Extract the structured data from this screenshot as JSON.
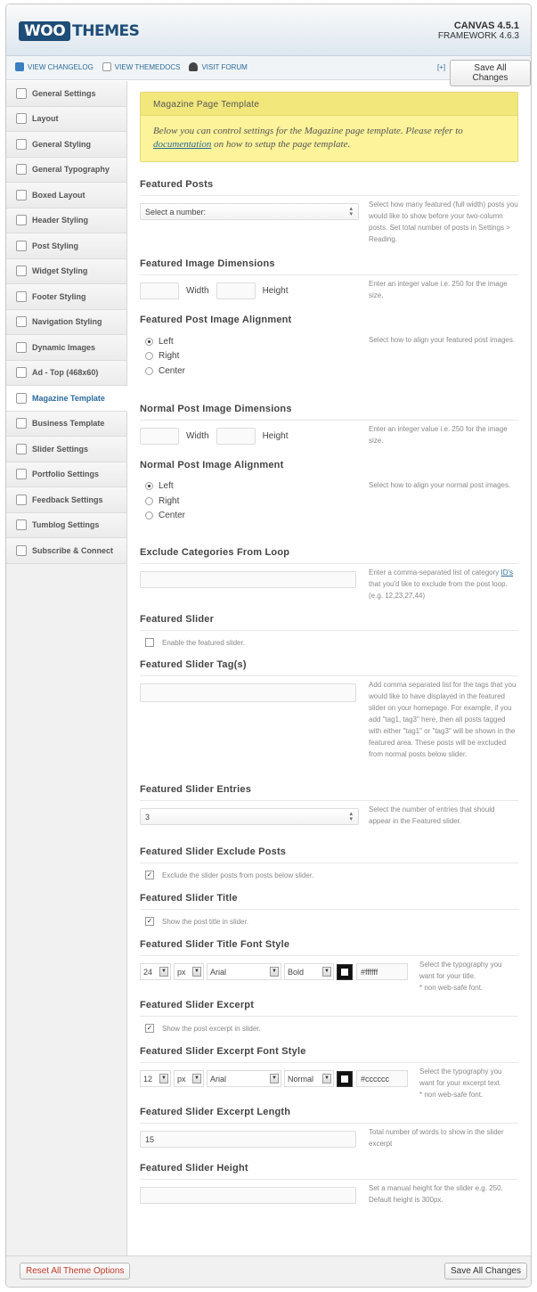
{
  "header": {
    "logo_woo": "WOO",
    "logo_themes": "THEMES",
    "version": "CANVAS 4.5.1",
    "framework": "FRAMEWORK 4.6.3"
  },
  "subbar": {
    "links": [
      {
        "label": "VIEW CHANGELOG",
        "icon": "changelog-icon"
      },
      {
        "label": "VIEW THEMEDOCS",
        "icon": "document-icon"
      },
      {
        "label": "VISIT FORUM",
        "icon": "user-icon"
      }
    ],
    "expand": "[+]",
    "save_label": "Save All Changes"
  },
  "sidebar": {
    "items": [
      {
        "label": "General Settings",
        "icon": "wrench-icon"
      },
      {
        "label": "Layout",
        "icon": "layout-icon"
      },
      {
        "label": "General Styling",
        "icon": "paint-bucket-icon"
      },
      {
        "label": "General Typography",
        "icon": "typography-icon"
      },
      {
        "label": "Boxed Layout",
        "icon": "box-icon"
      },
      {
        "label": "Header Styling",
        "icon": "header-icon"
      },
      {
        "label": "Post Styling",
        "icon": "post-icon"
      },
      {
        "label": "Widget Styling",
        "icon": "widget-icon"
      },
      {
        "label": "Footer Styling",
        "icon": "footer-icon"
      },
      {
        "label": "Navigation Styling",
        "icon": "compass-icon"
      },
      {
        "label": "Dynamic Images",
        "icon": "camera-icon"
      },
      {
        "label": "Ad - Top (468x60)",
        "icon": "megaphone-icon"
      },
      {
        "label": "Magazine Template",
        "icon": "magazine-icon",
        "active": true
      },
      {
        "label": "Business Template",
        "icon": "business-icon"
      },
      {
        "label": "Slider Settings",
        "icon": "slider-icon"
      },
      {
        "label": "Portfolio Settings",
        "icon": "pencil-icon"
      },
      {
        "label": "Feedback Settings",
        "icon": "feedback-icon"
      },
      {
        "label": "Tumblog Settings",
        "icon": "tumblr-icon"
      },
      {
        "label": "Subscribe & Connect",
        "icon": "connect-icon"
      }
    ]
  },
  "notice": {
    "title": "Magazine Page Template",
    "body_before": "Below you can control settings for the Magazine page template. Please refer to ",
    "link": "documentation",
    "body_after": " on how to setup the page template."
  },
  "sections": {
    "featured_posts": {
      "title": "Featured Posts",
      "select_value": "Select a number:",
      "desc": "Select how many featured (full width) posts you would like to show before your two-column posts. Set total number of posts in Settings > Reading."
    },
    "featured_image_dims": {
      "title": "Featured Image Dimensions",
      "width_label": "Width",
      "height_label": "Height",
      "desc": "Enter an integer value i.e. 250 for the image size."
    },
    "featured_alignment": {
      "title": "Featured Post Image Alignment",
      "options": [
        "Left",
        "Right",
        "Center"
      ],
      "selected": "Left",
      "desc": "Select how to align your featured post images."
    },
    "normal_image_dims": {
      "title": "Normal Post Image Dimensions",
      "width_label": "Width",
      "height_label": "Height",
      "desc": "Enter an integer value i.e. 250 for the image size."
    },
    "normal_alignment": {
      "title": "Normal Post Image Alignment",
      "options": [
        "Left",
        "Right",
        "Center"
      ],
      "selected": "Left",
      "desc": "Select how to align your normal post images."
    },
    "exclude_categories": {
      "title": "Exclude Categories From Loop",
      "value": "",
      "desc_before": "Enter a comma-separated list of category ",
      "desc_link": "ID's",
      "desc_after": " that you'd like to exclude from the post loop. (e.g. 12,23,27,44)"
    },
    "featured_slider": {
      "title": "Featured Slider",
      "checked": false,
      "label": "Enable the featured slider."
    },
    "slider_tags": {
      "title": "Featured Slider Tag(s)",
      "value": "",
      "desc": "Add comma separated list for the tags that you would like to have displayed in the featured slider on your homepage. For example, if you add \"tag1, tag3\" here, then all posts tagged with either \"tag1\" or \"tag3\" will be shown in the featured area. These posts will be excluded from normal posts below slider."
    },
    "slider_entries": {
      "title": "Featured Slider Entries",
      "select_value": "3",
      "desc": "Select the number of entries that should appear in the Featured slider."
    },
    "slider_exclude": {
      "title": "Featured Slider Exclude Posts",
      "checked": true,
      "label": "Exclude the slider posts from posts below slider."
    },
    "slider_title": {
      "title": "Featured Slider Title",
      "checked": true,
      "label": "Show the post title in slider."
    },
    "slider_title_font": {
      "title": "Featured Slider Title Font Style",
      "size": "24",
      "unit": "px",
      "family": "Arial",
      "weight": "Bold",
      "color": "#ffffff",
      "desc": "Select the typography you want for your title.",
      "note": "* non web-safe font."
    },
    "slider_excerpt": {
      "title": "Featured Slider Excerpt",
      "checked": true,
      "label": "Show the post excerpt in slider."
    },
    "slider_excerpt_font": {
      "title": "Featured Slider Excerpt Font Style",
      "size": "12",
      "unit": "px",
      "family": "Arial",
      "weight": "Normal",
      "color": "#cccccc",
      "desc": "Select the typography you want for your excerpt text.",
      "note": "* non web-safe font."
    },
    "excerpt_length": {
      "title": "Featured Slider Excerpt Length",
      "value": "15",
      "desc": "Total number of words to show in the slider excerpt"
    },
    "slider_height": {
      "title": "Featured Slider Height",
      "value": "",
      "desc": "Set a manual height for the slider e.g. 250. Default height is 300px."
    }
  },
  "footer": {
    "reset_label": "Reset All Theme Options",
    "save_label": "Save All Changes"
  },
  "colors": {
    "accent": "#2a6b9a",
    "notice_bg": "#fcf39a",
    "reset": "#c0392b"
  }
}
